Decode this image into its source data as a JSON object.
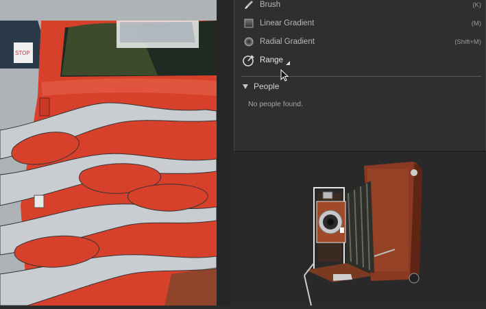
{
  "tools": [
    {
      "name": "Brush",
      "shortcut": "(K)",
      "icon": "brush-icon"
    },
    {
      "name": "Linear Gradient",
      "shortcut": "(M)",
      "icon": "linear-gradient-icon"
    },
    {
      "name": "Radial Gradient",
      "shortcut": "(Shift+M)",
      "icon": "radial-gradient-icon"
    },
    {
      "name": "Range",
      "shortcut": "",
      "icon": "range-mask-icon"
    }
  ],
  "people": {
    "title": "People",
    "empty_message": "No people found."
  },
  "colors": {
    "panel_bg": "#2f2f2f",
    "car_red": "#d9402a",
    "flame_silver": "#c9cdd2",
    "camera_leather": "#8a3a22"
  }
}
